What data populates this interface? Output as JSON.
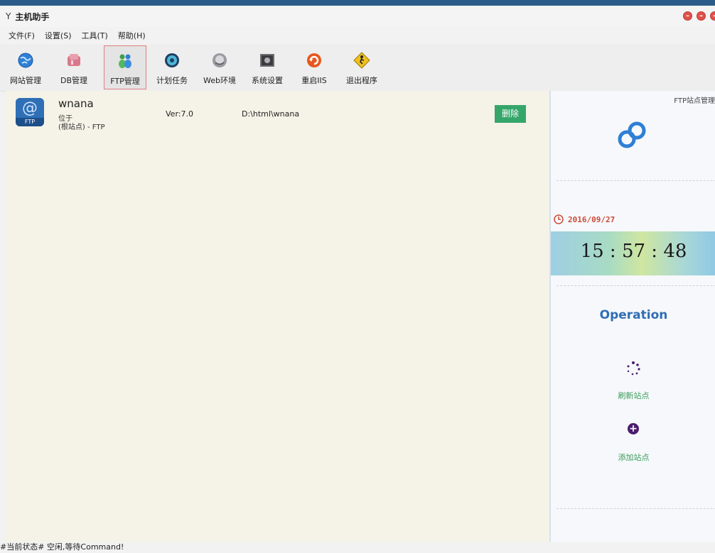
{
  "window": {
    "title": "主机助手",
    "title_glyph": "Y"
  },
  "menu": [
    "文件(F)",
    "设置(S)",
    "工具(T)",
    "帮助(H)"
  ],
  "toolbar": {
    "buttons": [
      {
        "label": "网站管理",
        "icon": "globe-icon"
      },
      {
        "label": "DB管理",
        "icon": "database-icon"
      },
      {
        "label": "FTP管理",
        "icon": "users-icon",
        "selected": true
      },
      {
        "label": "计划任务",
        "icon": "clock-icon"
      },
      {
        "label": "Web环境",
        "icon": "server-icon"
      },
      {
        "label": "系统设置",
        "icon": "settings-icon"
      },
      {
        "label": "重启IIS",
        "icon": "restart-icon"
      },
      {
        "label": "退出程序",
        "icon": "exit-icon"
      }
    ]
  },
  "sites": [
    {
      "name": "wnana",
      "location_label": "位于",
      "root_label": "(根站点) - FTP",
      "version": "Ver:7.0",
      "path": "D:\\html\\wnana",
      "delete_label": "删除",
      "icon_at": "@",
      "icon_text": "FTP"
    }
  ],
  "panel": {
    "title": "FTP站点管理",
    "date": "2016/09/27",
    "time": "15 : 57 : 48",
    "operation_title": "Operation",
    "refresh_label": "刷新站点",
    "add_label": "添加站点",
    "add_glyph": "+"
  },
  "status": {
    "text": "#当前状态# 空闲,等待Command!"
  },
  "colors": {
    "accent_blue": "#2f6db5",
    "delete_green": "#35a66a",
    "date_red": "#cc4a38",
    "label_green": "#3a9b5a",
    "add_purple": "#4b1d6e"
  }
}
